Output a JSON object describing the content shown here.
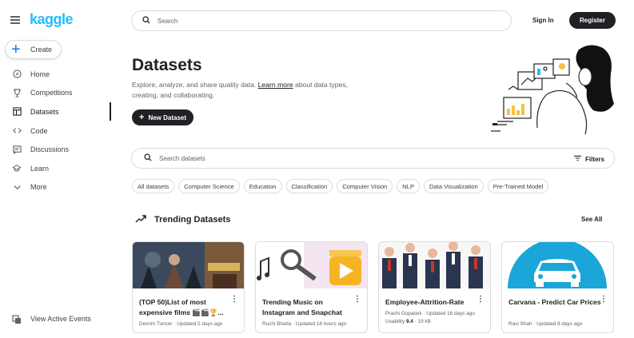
{
  "brand": {
    "logo_text": "kaggle",
    "logo_color": "#20beff"
  },
  "sidebar": {
    "create_label": "Create",
    "items": [
      {
        "label": "Home",
        "icon": "compass-icon"
      },
      {
        "label": "Competitions",
        "icon": "trophy-icon"
      },
      {
        "label": "Datasets",
        "icon": "table-icon",
        "active": true
      },
      {
        "label": "Code",
        "icon": "code-icon"
      },
      {
        "label": "Discussions",
        "icon": "comments-icon"
      },
      {
        "label": "Learn",
        "icon": "graduation-cap-icon"
      },
      {
        "label": "More",
        "icon": "chevron-down-icon"
      }
    ],
    "view_events_label": "View Active Events"
  },
  "header": {
    "search_placeholder": "Search",
    "signin_label": "Sign In",
    "register_label": "Register"
  },
  "hero": {
    "title": "Datasets",
    "desc_before": "Explore, analyze, and share quality data. ",
    "desc_link": "Learn more",
    "desc_after": " about data types, creating, and collaborating.",
    "new_dataset_label": "New Dataset"
  },
  "dataset_search": {
    "placeholder": "Search datasets",
    "filters_label": "Filters"
  },
  "chips": [
    "All datasets",
    "Computer Science",
    "Education",
    "Classification",
    "Computer Vision",
    "NLP",
    "Data Visualization",
    "Pre-Trained Model"
  ],
  "trending": {
    "title": "Trending Datasets",
    "see_all_label": "See All",
    "cards": [
      {
        "title": "(TOP 50)List of most expensive films 🎬🎬🏆...",
        "meta1": "Devrim Tuncer · Updated 5 days ago",
        "meta2": ""
      },
      {
        "title": "Trending Music on Instagram and Snapchat",
        "meta1": "Ruchi Bhatia · Updated 18 hours ago",
        "meta2": ""
      },
      {
        "title": "Employee-Attrition-Rate",
        "meta1": "Prachi Gopalani · Updated 16 days ago",
        "usability_label": "Usability",
        "usability_value": "9.4",
        "size": "· 19 kB"
      },
      {
        "title": "Carvana - Predict Car Prices",
        "meta1": "Ravi Shah · Updated 8 days ago",
        "meta2": ""
      }
    ]
  },
  "colors": {
    "primary_dark": "#202124",
    "border": "#dadce0",
    "muted": "#5f6368"
  }
}
